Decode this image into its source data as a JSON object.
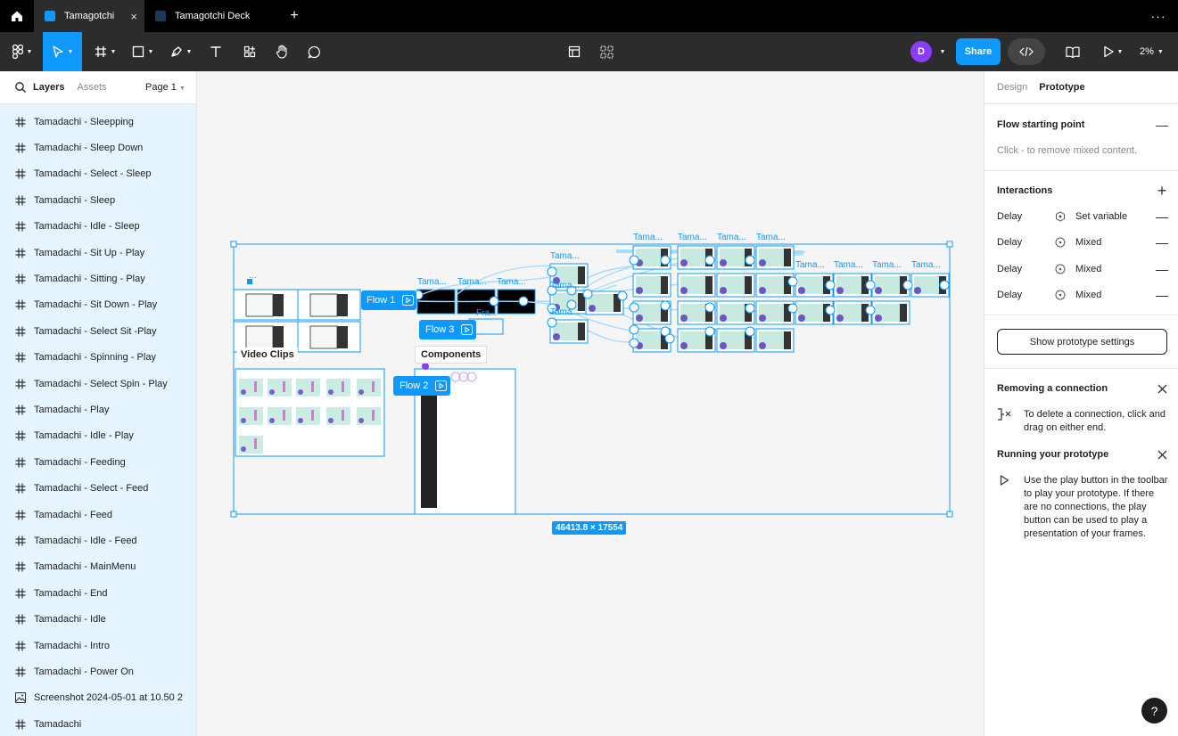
{
  "tabs": [
    {
      "label": "Tamagotchi",
      "active": true
    },
    {
      "label": "Tamagotchi Deck",
      "active": false
    }
  ],
  "tab_close": "×",
  "new_tab": "+",
  "more": "···",
  "toolbar": {
    "avatar_initial": "D",
    "share_label": "Share",
    "zoom": "2%"
  },
  "left_panel": {
    "layers_tab": "Layers",
    "assets_tab": "Assets",
    "page": "Page 1",
    "layers": [
      {
        "label": "Tamadachi - Sleepping",
        "icon": "frame-icon"
      },
      {
        "label": "Tamadachi - Sleep Down",
        "icon": "frame-icon"
      },
      {
        "label": "Tamadachi - Select - Sleep",
        "icon": "frame-icon"
      },
      {
        "label": "Tamadachi - Sleep",
        "icon": "frame-icon"
      },
      {
        "label": "Tamadachi - Idle - Sleep",
        "icon": "frame-icon"
      },
      {
        "label": "Tamadachi - Sit Up - Play",
        "icon": "frame-icon"
      },
      {
        "label": "Tamadachi - Sitting - Play",
        "icon": "frame-icon"
      },
      {
        "label": "Tamadachi - Sit Down - Play",
        "icon": "frame-icon"
      },
      {
        "label": "Tamadachi - Select Sit -Play",
        "icon": "frame-icon"
      },
      {
        "label": "Tamadachi - Spinning - Play",
        "icon": "frame-icon"
      },
      {
        "label": "Tamadachi - Select Spin - Play",
        "icon": "frame-icon"
      },
      {
        "label": "Tamadachi - Play",
        "icon": "frame-icon"
      },
      {
        "label": "Tamadachi - Idle - Play",
        "icon": "frame-icon"
      },
      {
        "label": "Tamadachi - Feeding",
        "icon": "frame-icon"
      },
      {
        "label": "Tamadachi - Select - Feed",
        "icon": "frame-icon"
      },
      {
        "label": "Tamadachi - Feed",
        "icon": "frame-icon"
      },
      {
        "label": "Tamadachi - Idle - Feed",
        "icon": "frame-icon"
      },
      {
        "label": "Tamadachi - MainMenu",
        "icon": "frame-icon"
      },
      {
        "label": "Tamadachi - End",
        "icon": "frame-icon"
      },
      {
        "label": "Tamadachi - Idle",
        "icon": "frame-icon"
      },
      {
        "label": "Tamadachi - Intro",
        "icon": "frame-icon"
      },
      {
        "label": "Tamadachi - Power On",
        "icon": "frame-icon"
      },
      {
        "label": "Screenshot 2024-05-01 at 10.50 2",
        "icon": "image-icon"
      },
      {
        "label": "Tamadachi",
        "icon": "frame-icon"
      }
    ]
  },
  "canvas": {
    "flow1": "Flow 1",
    "flow2": "Flow 2",
    "flow3": "Flow 3",
    "video_clips": "Video Clips",
    "components": "Components",
    "dimensions": "46413.8 × 17554",
    "frame_label": "Tama...",
    "small_label": "Fra..."
  },
  "right_panel": {
    "design_tab": "Design",
    "prototype_tab": "Prototype",
    "flow_title": "Flow starting point",
    "flow_sub": "Click - to remove mixed content.",
    "interactions_title": "Interactions",
    "interactions": [
      {
        "trigger": "Delay",
        "action": "Set variable"
      },
      {
        "trigger": "Delay",
        "action": "Mixed"
      },
      {
        "trigger": "Delay",
        "action": "Mixed"
      },
      {
        "trigger": "Delay",
        "action": "Mixed"
      }
    ],
    "proto_settings": "Show prototype settings",
    "removing_title": "Removing a connection",
    "removing_text": "To delete a connection, click and drag on either end.",
    "running_title": "Running your prototype",
    "running_text": "Use the play button in the toolbar to play your prototype. If there are no connections, the play button can be used to play a presentation of your frames."
  },
  "help": "?",
  "colors": {
    "accent": "#0d99ff",
    "avatar": "#8c3cff",
    "selection_bg": "#e5f4ff"
  }
}
